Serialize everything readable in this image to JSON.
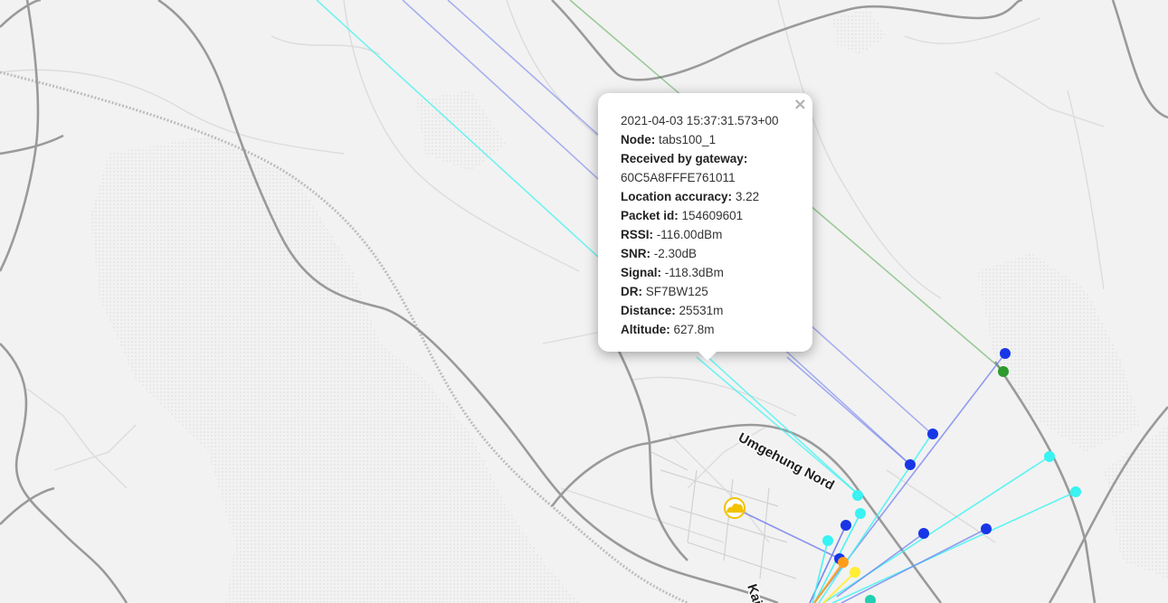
{
  "map": {
    "label_umgehung": "Umgehung Nord",
    "label_partial": "Kais",
    "marker_icon": "cloud-marker-icon",
    "colors": {
      "blue": "#1836e6",
      "cyan": "#39f2f2",
      "green": "#2c9a2c",
      "orange": "#ff9d1a",
      "yellow": "#ffee33",
      "teal": "#20d0b0",
      "marker": "#f2c200"
    }
  },
  "popup": {
    "close_label": "×",
    "timestamp": "2021-04-03 15:37:31.573+00",
    "fields": [
      {
        "label": "Node:",
        "value": "tabs100_1"
      },
      {
        "label": "Received by gateway:",
        "value": ""
      },
      {
        "label": "",
        "value": "60C5A8FFFE761011"
      },
      {
        "label": "Location accuracy:",
        "value": "3.22"
      },
      {
        "label": "Packet id:",
        "value": "154609601"
      },
      {
        "label": "RSSI:",
        "value": "-116.00dBm"
      },
      {
        "label": "SNR:",
        "value": "-2.30dB"
      },
      {
        "label": "Signal:",
        "value": "-118.3dBm"
      },
      {
        "label": "DR:",
        "value": "SF7BW125"
      },
      {
        "label": "Distance:",
        "value": "25531m"
      },
      {
        "label": "Altitude:",
        "value": "627.8m"
      }
    ]
  }
}
